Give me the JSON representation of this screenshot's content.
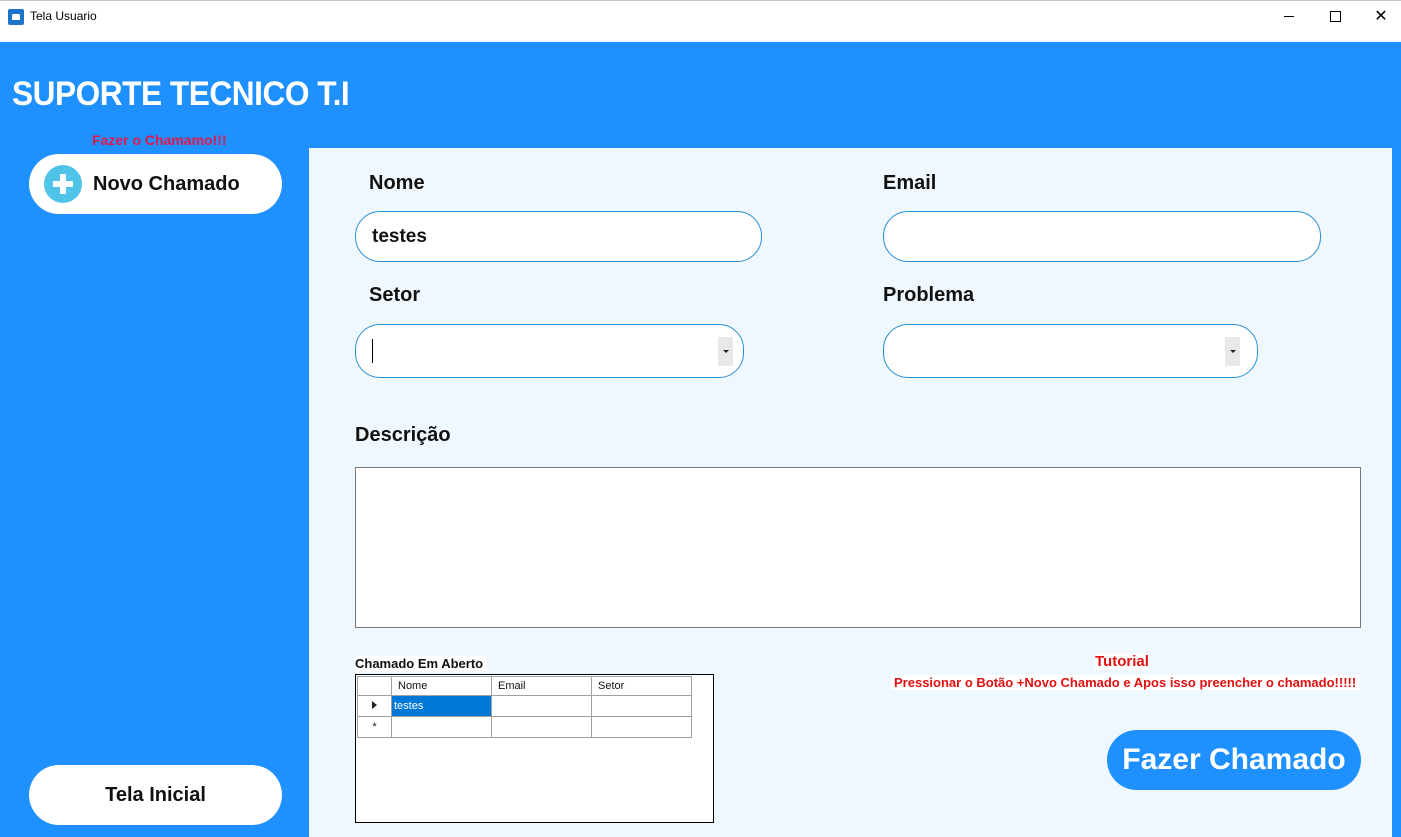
{
  "window": {
    "title": "Tela Usuario",
    "minimize_icon": "minimize-icon",
    "maximize_icon": "maximize-icon",
    "close_icon": "close-icon"
  },
  "header": {
    "title": "SUPORTE TECNICO T.I"
  },
  "sidebar": {
    "hint": "Fazer o Chamamo!!!",
    "new_ticket_label": "Novo Chamado",
    "new_ticket_icon": "plus-circle-icon",
    "home_label": "Tela Inicial"
  },
  "form": {
    "name_label": "Nome",
    "name_value": "testes",
    "email_label": "Email",
    "email_value": "",
    "sector_label": "Setor",
    "sector_value": "",
    "problem_label": "Problema",
    "problem_value": "",
    "description_label": "Descrição",
    "description_value": ""
  },
  "grid": {
    "title": "Chamado Em Aberto",
    "columns": [
      "Nome",
      "Email",
      "Setor"
    ],
    "rows": [
      {
        "marker": "current",
        "cells": [
          "testes",
          "",
          ""
        ]
      },
      {
        "marker": "new",
        "cells": [
          "",
          "",
          ""
        ]
      }
    ],
    "new_row_marker": "*"
  },
  "tutorial": {
    "title": "Tutorial",
    "text": "Pressionar o Botão +Novo Chamado e Apos isso preencher o chamado!!!!!"
  },
  "actions": {
    "submit_label": "Fazer Chamado"
  },
  "colors": {
    "primary": "#1e90ff",
    "panel": "#f0f8ff",
    "hint": "#e0194a",
    "tutorial": "#e01010",
    "selection": "#0078d7"
  }
}
